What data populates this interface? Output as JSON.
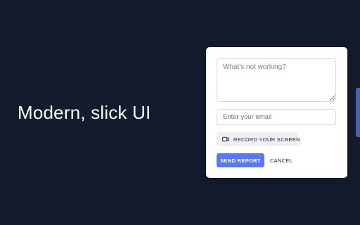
{
  "hero": {
    "headline": "Modern, slick UI"
  },
  "feedback_form": {
    "issue_placeholder": "What's not working?",
    "issue_value": "",
    "email_placeholder": "Enter your email",
    "email_value": "",
    "record_label": "RECORD YOUR SCREEN",
    "record_icon": "video-camera-icon",
    "send_label": "SEND REPORT",
    "cancel_label": "CANCEL"
  },
  "colors": {
    "background": "#141b2c",
    "accent": "#5b77f2",
    "side_tab": "#4c5fb6",
    "card": "#ffffff"
  }
}
